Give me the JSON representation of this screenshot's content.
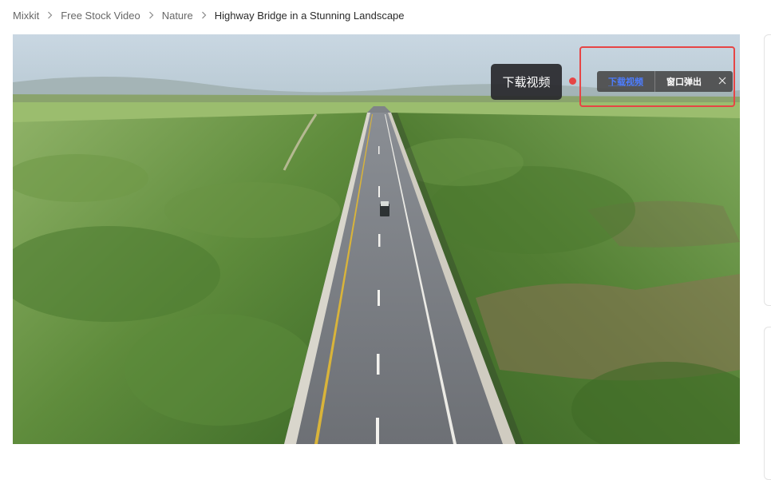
{
  "breadcrumb": {
    "items": [
      "Mixkit",
      "Free Stock Video",
      "Nature"
    ],
    "current": "Highway Bridge in a Stunning Landscape"
  },
  "video": {
    "title": "Highway Bridge in a Stunning Landscape"
  },
  "overlay": {
    "tooltip_label": "下载视频",
    "download_button_label": "下载视频",
    "window_popup_label": "窗口弹出",
    "close_icon": "close-icon",
    "highlight_color": "#e64545",
    "download_accent": "#4d7dff"
  }
}
